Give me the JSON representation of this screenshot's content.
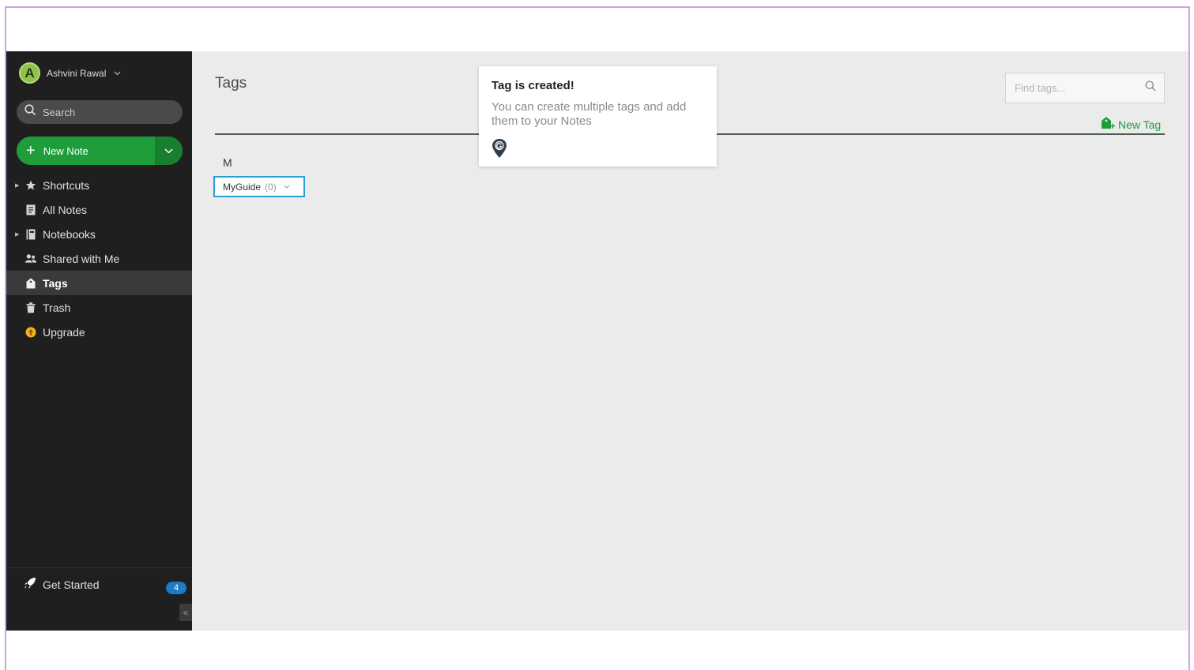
{
  "sidebar": {
    "user_name": "Ashvini Rawal",
    "avatar_letter": "A",
    "search_label": "Search",
    "new_note_label": "New Note",
    "items": [
      {
        "label": "Shortcuts",
        "icon": "star-icon",
        "expandable": true,
        "active": false
      },
      {
        "label": "All Notes",
        "icon": "notes-icon",
        "expandable": false,
        "active": false
      },
      {
        "label": "Notebooks",
        "icon": "notebook-icon",
        "expandable": true,
        "active": false
      },
      {
        "label": "Shared with Me",
        "icon": "people-icon",
        "expandable": false,
        "active": false
      },
      {
        "label": "Tags",
        "icon": "tag-icon",
        "expandable": false,
        "active": true
      },
      {
        "label": "Trash",
        "icon": "trash-icon",
        "expandable": false,
        "active": false
      },
      {
        "label": "Upgrade",
        "icon": "upgrade-icon",
        "expandable": false,
        "active": false
      }
    ],
    "get_started_label": "Get Started",
    "get_started_count": "4",
    "collapse_glyph": "«"
  },
  "main": {
    "title": "Tags",
    "find_placeholder": "Find tags...",
    "new_tag_label": "New Tag",
    "letter_group": "M",
    "tags": [
      {
        "name": "MyGuide",
        "count": "(0)"
      }
    ]
  },
  "popup": {
    "title": "Tag is created!",
    "body": "You can create multiple tags and add them to your Notes"
  },
  "colors": {
    "accent_green": "#1f9d3a",
    "sidebar_bg": "#1f1f1f",
    "chip_border": "#2a9fd6",
    "badge_blue": "#1a7cc4"
  }
}
